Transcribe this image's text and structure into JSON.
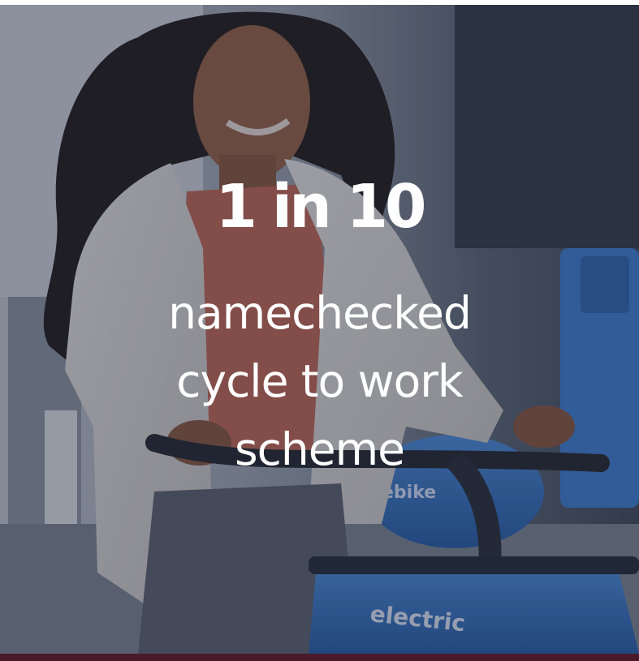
{
  "stat": {
    "headline": "1 in 10",
    "lines": [
      "namechecked",
      "cycle to work",
      "scheme"
    ]
  },
  "photo": {
    "bike_text": "electric",
    "dock_text": "ebike"
  },
  "colors": {
    "overlay": "#262d42",
    "text": "#ffffff",
    "footer_bar": "#4a1a2a",
    "bike_blue": "#2f6fc4"
  }
}
